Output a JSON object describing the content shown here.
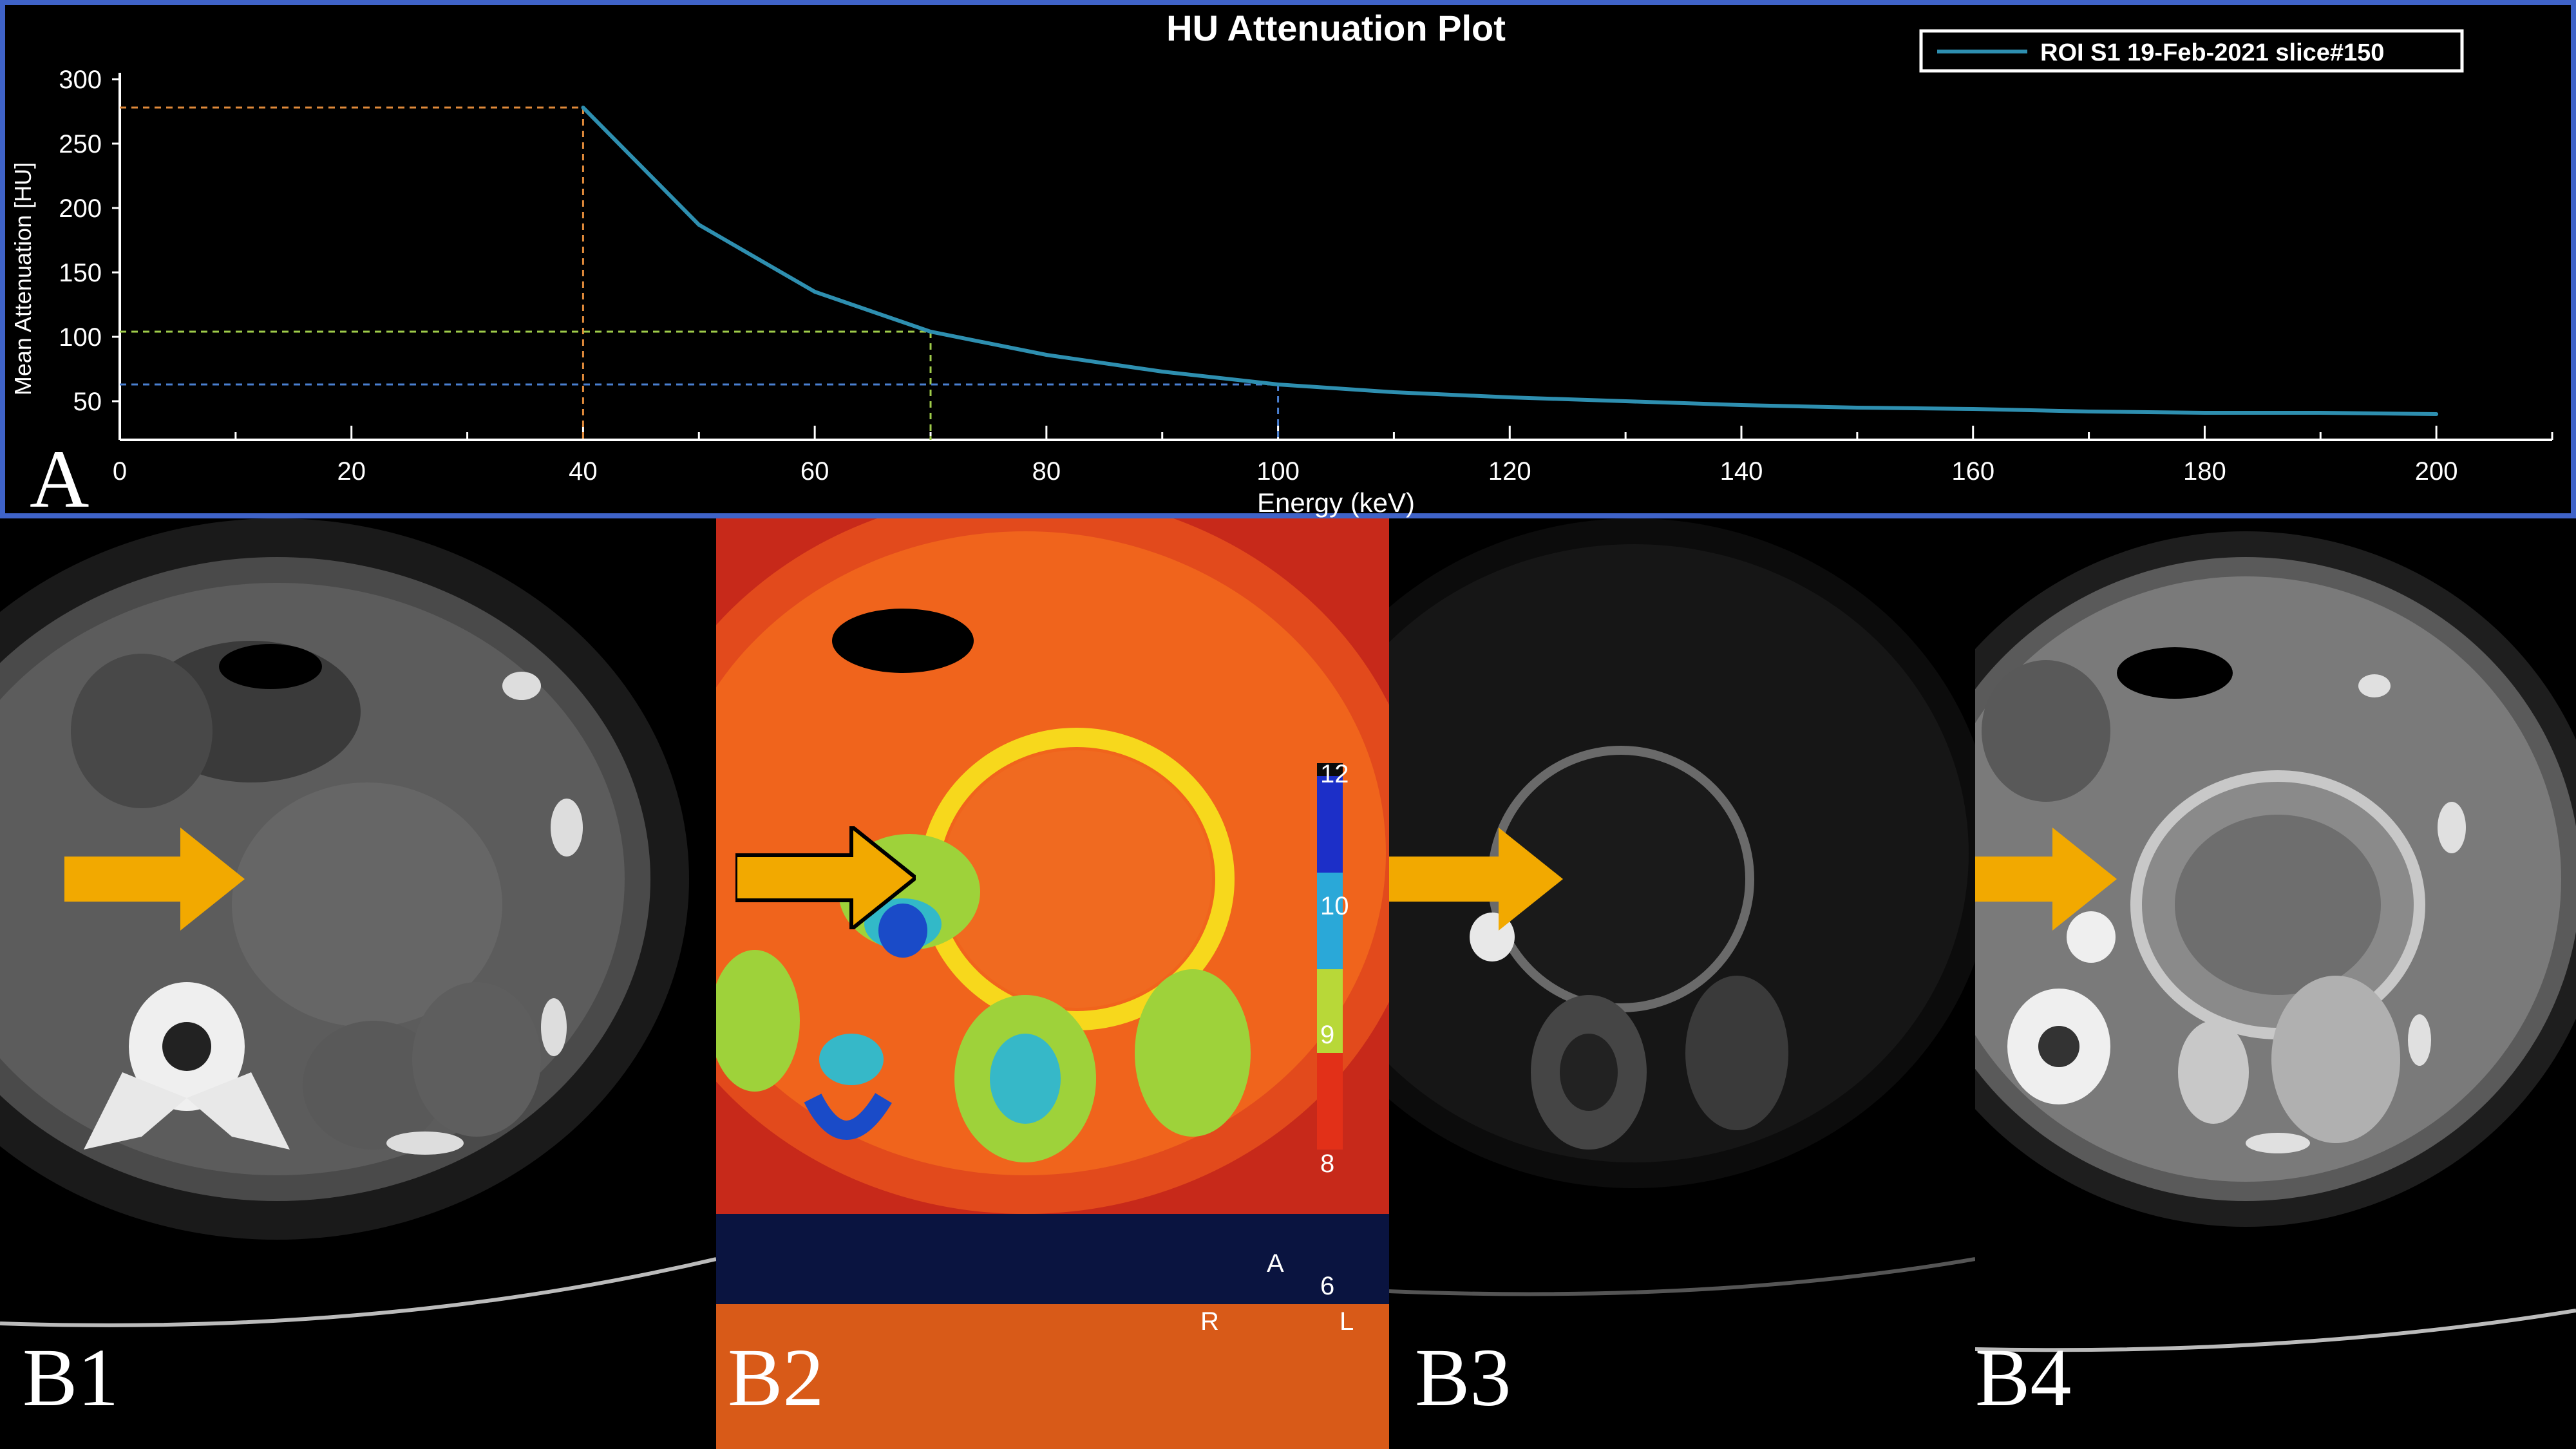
{
  "chart_data": {
    "type": "line",
    "title": "HU Attenuation Plot",
    "xlabel": "Energy (keV)",
    "ylabel": "Mean Attenuation [HU]",
    "xlim": [
      0,
      210
    ],
    "ylim": [
      20,
      300
    ],
    "xticks": [
      0,
      20,
      40,
      60,
      80,
      100,
      120,
      140,
      160,
      180,
      200
    ],
    "yticks": [
      50,
      100,
      150,
      200,
      250,
      300
    ],
    "legend_position": "top-right",
    "series": [
      {
        "name": "ROI S1 19-Feb-2021 slice#150",
        "color": "#2e8fb0",
        "x": [
          40,
          50,
          60,
          70,
          80,
          90,
          100,
          110,
          120,
          130,
          140,
          150,
          160,
          170,
          180,
          190,
          200
        ],
        "y": [
          278,
          187,
          135,
          104,
          86,
          73,
          63,
          57,
          53,
          50,
          47,
          45,
          44,
          42,
          41,
          41,
          40
        ]
      }
    ],
    "reference_lines": [
      {
        "x": 40,
        "y": 278,
        "color": "#e08a3a"
      },
      {
        "x": 70,
        "y": 104,
        "color": "#9fcc4a"
      },
      {
        "x": 100,
        "y": 63,
        "color": "#4a7fd0"
      }
    ],
    "grid": false
  },
  "panels": {
    "a_label": "A",
    "b1_label": "B1",
    "b2_label": "B2",
    "b3_label": "B3",
    "b4_label": "B4"
  },
  "colorbar": {
    "ticks": [
      "12",
      "10",
      "9",
      "8",
      "6"
    ]
  },
  "orientation_markers": {
    "anterior": "A",
    "right": "R",
    "left": "L"
  },
  "colors": {
    "panel_border": "#3f63c8",
    "arrow": "#f2a900",
    "axis": "#ffffff"
  },
  "icons": {
    "arrow": "right-arrow-icon"
  }
}
